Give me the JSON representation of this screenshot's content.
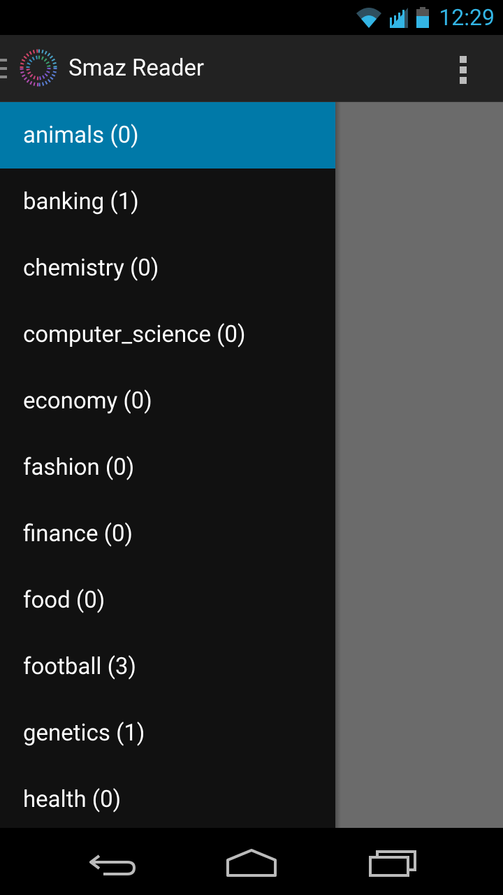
{
  "status_bar": {
    "time": "12:29",
    "icons": [
      "wifi-icon",
      "cell-signal-icon",
      "battery-icon"
    ],
    "accent_color": "#33b5e5"
  },
  "action_bar": {
    "title": "Smaz Reader",
    "menu_icon": "drawer-indicator-icon",
    "logo_icon": "app-logo-icon",
    "overflow_icon": "overflow-menu-icon"
  },
  "drawer": {
    "selected_color": "#0079a8",
    "items": [
      {
        "label": "animals (0)",
        "selected": true
      },
      {
        "label": "banking (1)",
        "selected": false
      },
      {
        "label": "chemistry (0)",
        "selected": false
      },
      {
        "label": "computer_science (0)",
        "selected": false
      },
      {
        "label": "economy (0)",
        "selected": false
      },
      {
        "label": "fashion (0)",
        "selected": false
      },
      {
        "label": "finance (0)",
        "selected": false
      },
      {
        "label": "food (0)",
        "selected": false
      },
      {
        "label": "football (3)",
        "selected": false
      },
      {
        "label": "genetics (1)",
        "selected": false
      },
      {
        "label": "health (0)",
        "selected": false
      }
    ]
  },
  "nav_bar": {
    "buttons": [
      "back-icon",
      "home-icon",
      "recents-icon"
    ]
  }
}
